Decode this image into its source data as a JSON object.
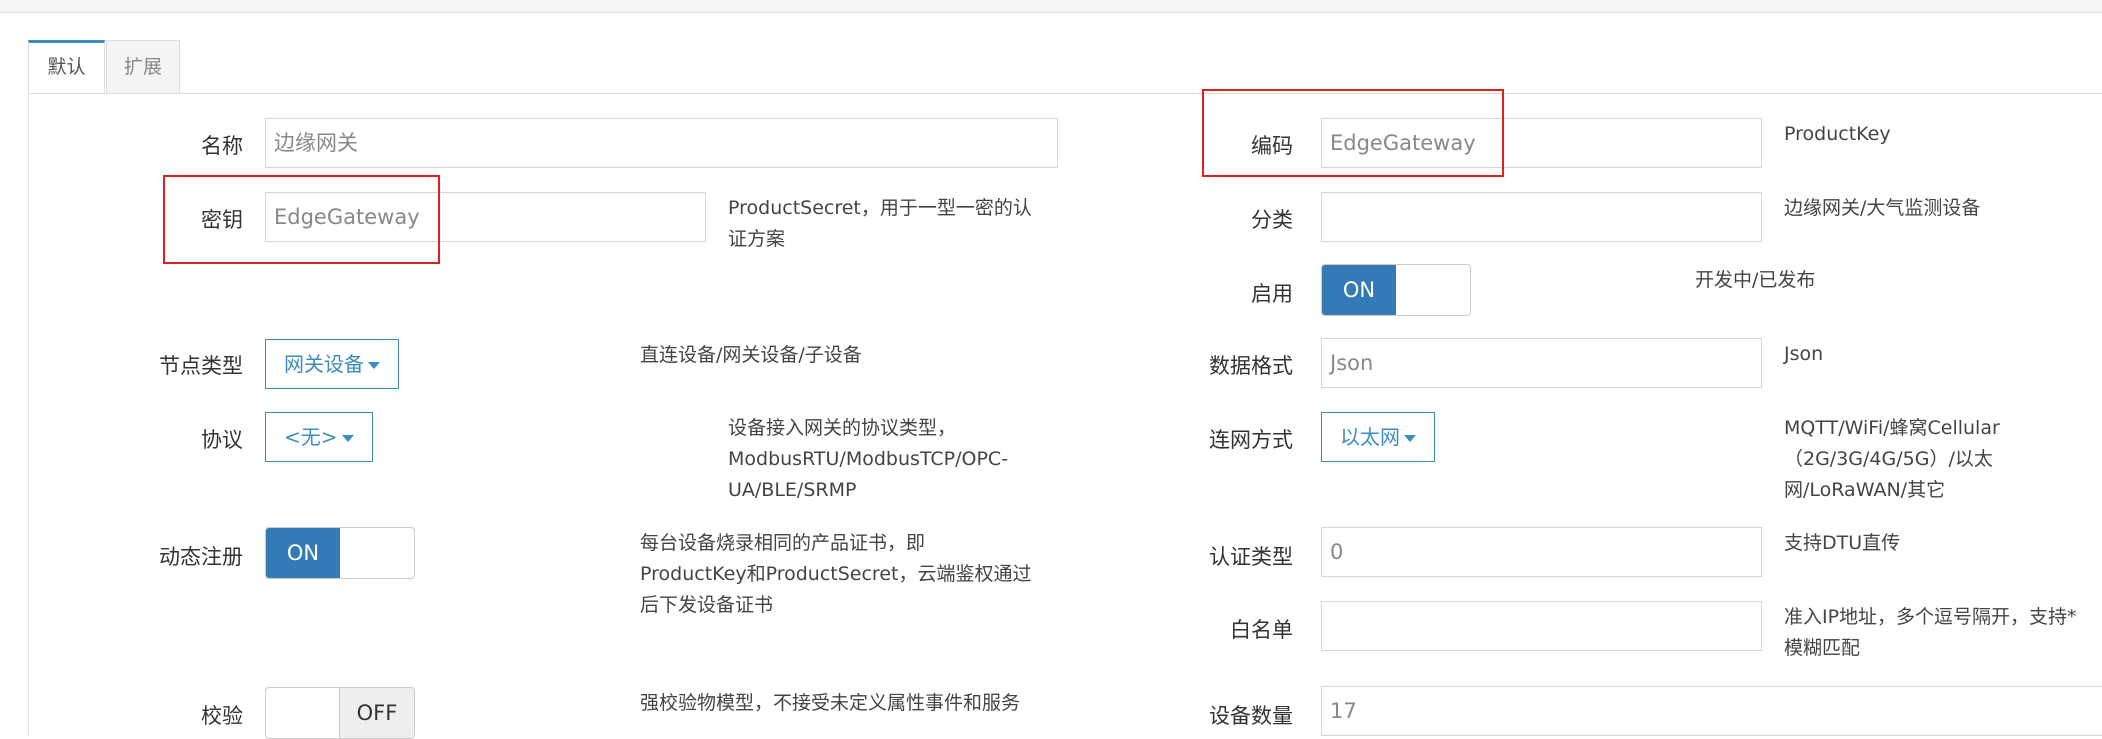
{
  "tabs": [
    {
      "label": "默认"
    },
    {
      "label": "扩展"
    }
  ],
  "left": {
    "name": {
      "label": "名称",
      "value": "边缘网关"
    },
    "secret": {
      "label": "密钥",
      "value": "EdgeGateway",
      "help": [
        "ProductSecret，用于一型一密的认",
        "证方案"
      ]
    },
    "node_type": {
      "label": "节点类型",
      "value": "网关设备",
      "help": "直连设备/网关设备/子设备"
    },
    "protocol": {
      "label": "协议",
      "value": "<无>",
      "help": [
        "设备接入网关的协议类型，",
        "ModbusRTU/ModbusTCP/OPC-",
        "UA/BLE/SRMP"
      ]
    },
    "dynamic_register": {
      "label": "动态注册",
      "state": "ON",
      "help": [
        "每台设备烧录相同的产品证书，即",
        "ProductKey和ProductSecret，云端鉴权通过",
        "后下发设备证书"
      ]
    },
    "verify": {
      "label": "校验",
      "state": "OFF",
      "help": "强校验物模型，不接受未定义属性事件和服务"
    }
  },
  "right": {
    "code": {
      "label": "编码",
      "value": "EdgeGateway",
      "help": "ProductKey"
    },
    "category": {
      "label": "分类",
      "value": "",
      "help": "边缘网关/大气监测设备"
    },
    "enabled": {
      "label": "启用",
      "state": "ON",
      "help": "开发中/已发布"
    },
    "data_format": {
      "label": "数据格式",
      "value": "Json",
      "help": "Json"
    },
    "network": {
      "label": "连网方式",
      "value": "以太网",
      "help": [
        "MQTT/WiFi/蜂窝Cellular",
        "（2G/3G/4G/5G）/以太",
        "网/LoRaWAN/其它"
      ]
    },
    "auth_type": {
      "label": "认证类型",
      "value": "0",
      "help": "支持DTU直传"
    },
    "whitelist": {
      "label": "白名单",
      "value": "",
      "help": [
        "准入IP地址，多个逗号隔开，支持*",
        "模糊匹配"
      ]
    },
    "device_count": {
      "label": "设备数量",
      "value": "17"
    }
  },
  "colors": {
    "accent": "#3c8dbc",
    "switch_on": "#337ab7",
    "highlight": "#e02020"
  }
}
